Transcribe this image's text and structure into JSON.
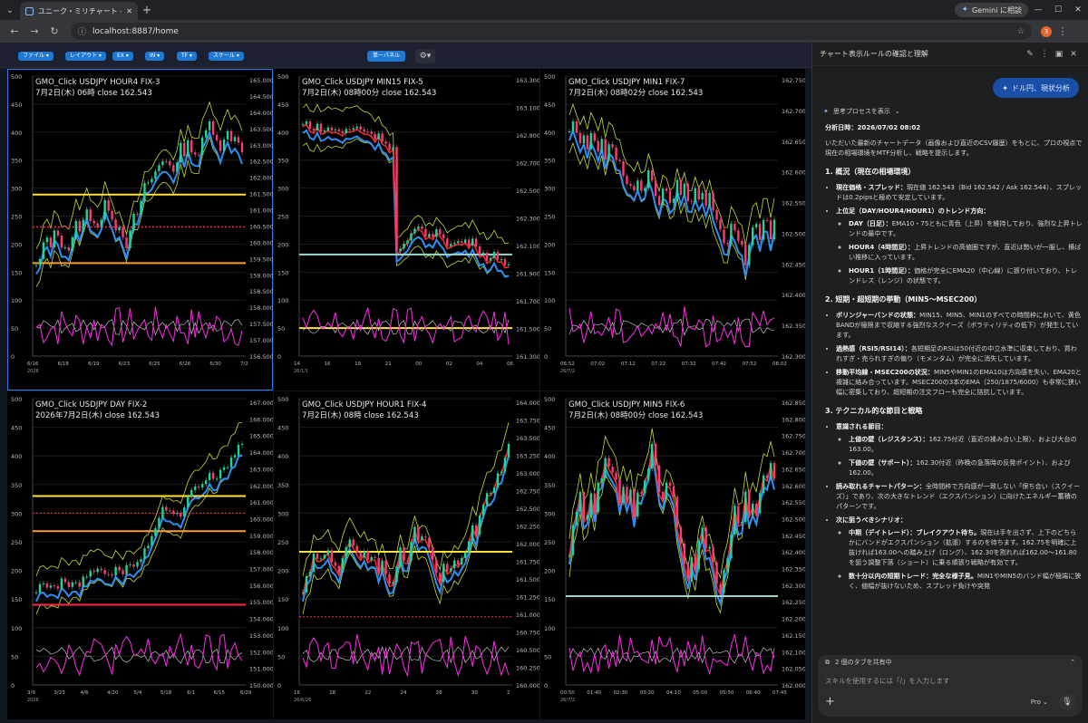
{
  "browser": {
    "tab_title": "ユニーク・ミリチャート - My-No5-un",
    "url": "localhost:8887/home",
    "gemini_button": "Gemini に相談",
    "ext_badge": "3"
  },
  "toolbar": {
    "buttons": [
      "ファイル",
      "レイアウト",
      "EX",
      "IN",
      "TF",
      "スケール"
    ],
    "single_panel": "単一パネル"
  },
  "colors": {
    "sma": "#ffe13a",
    "resist": "#ff2a4a",
    "band": "#c2dc37",
    "ema": "#2e8ff0",
    "rsi": "#ff2de8",
    "bull": "#21d49a",
    "bear": "#ff3b76",
    "support": "#9ad8d0"
  },
  "panels": [
    {
      "t1": "GMO_Click USDJPY HOUR4 FIX-3",
      "t2": "7月2日(木) 06時 close 162.543",
      "r": [
        "165.000",
        "164.500",
        "164.000",
        "163.500",
        "163.000",
        "162.500",
        "162.000",
        "161.500",
        "161.000",
        "160.500",
        "160.000",
        "159.500",
        "159.000",
        "158.500",
        "158.000",
        "157.500",
        "157.000",
        "156.500"
      ],
      "x": [
        "6/16",
        "6/18",
        "6/19",
        "6/23",
        "6/25",
        "6/26",
        "6/30",
        "7/2"
      ],
      "y2": "2026",
      "hl": [
        {
          "y": 0.423,
          "c": "#ffe13a",
          "w": 2
        },
        {
          "y": 0.539,
          "c": "#ff2a4a",
          "w": 1.5,
          "d": "2 2"
        },
        {
          "y": 0.668,
          "c": "#ff9d2a",
          "w": 2
        }
      ]
    },
    {
      "t1": "GMO_Click USDJPY MIN15 FIX-5",
      "t2": "7月2日(木) 08時00分 close 162.543",
      "r": [
        "163.300",
        "163.100",
        "162.900",
        "162.700",
        "162.500",
        "162.300",
        "162.100",
        "161.900",
        "161.700",
        "161.500",
        "161.300"
      ],
      "x": [
        "14",
        "16",
        "19",
        "21",
        "00",
        "02",
        "04",
        "06"
      ],
      "y2": "26/1/1",
      "hl": [
        {
          "y": 0.637,
          "c": "#9ad8d0",
          "w": 2
        },
        {
          "y": 0.9,
          "c": "#ffe13a",
          "w": 2
        }
      ]
    },
    {
      "t1": "GMO_Click USDJPY MIN1 FIX-7",
      "t2": "7月2日(木) 08時02分 close 162.543",
      "r": [
        "162.750",
        "162.700",
        "162.650",
        "162.600",
        "162.550",
        "162.500",
        "162.450",
        "162.400",
        "162.350",
        "162.300"
      ],
      "x": [
        "06:52",
        "07:02",
        "07:12",
        "07:22",
        "07:32",
        "07:42",
        "07:52",
        "08:02"
      ],
      "y2": "26/7/2",
      "hl": []
    },
    {
      "t1": "GMO_Click USDJPY DAY FIX-2",
      "t2": "2026年7月2日(木) close 162.543",
      "r": [
        "167.000",
        "166.000",
        "165.000",
        "164.000",
        "163.000",
        "162.000",
        "161.000",
        "160.000",
        "159.000",
        "158.000",
        "157.000",
        "156.000",
        "155.000",
        "154.000",
        "153.000",
        "152.000",
        "151.000",
        "150.000"
      ],
      "x": [
        "3/9",
        "3/23",
        "4/6",
        "4/20",
        "5/4",
        "5/18",
        "6/1",
        "6/15",
        "6/29"
      ],
      "y2": "2026",
      "hl": [
        {
          "y": 0.34,
          "c": "#ffe13a",
          "w": 2
        },
        {
          "y": 0.4,
          "c": "#ff2a4a",
          "w": 1,
          "d": "2 2"
        },
        {
          "y": 0.463,
          "c": "#ff9d2a",
          "w": 2
        },
        {
          "y": 0.72,
          "c": "#ff2a4a",
          "w": 2
        }
      ]
    },
    {
      "t1": "GMO_Click USDJPY HOUR1 FIX-4",
      "t2": "7月2日(木) 08時 close 162.543",
      "r": [
        "164.000",
        "163.750",
        "163.500",
        "163.250",
        "163.000",
        "162.750",
        "162.500",
        "162.250",
        "162.000",
        "161.750",
        "161.500",
        "161.250",
        "161.000",
        "160.750",
        "160.500",
        "160.250",
        "160.000"
      ],
      "x": [
        "16",
        "18",
        "22",
        "24",
        "28",
        "30",
        "2"
      ],
      "y2": "26/6/26",
      "hl": [
        {
          "y": 0.535,
          "c": "#ffe13a",
          "w": 2
        },
        {
          "y": 0.762,
          "c": "#ff2a4a",
          "w": 1,
          "d": "2 2"
        }
      ]
    },
    {
      "t1": "GMO_Click USDJPY MIN5 FIX-6",
      "t2": "7月2日(木) 08時00分 close 162.543",
      "r": [
        "162.850",
        "162.800",
        "162.750",
        "162.700",
        "162.650",
        "162.600",
        "162.550",
        "162.500",
        "162.450",
        "162.400",
        "162.350",
        "162.300",
        "162.250",
        "162.200",
        "162.150",
        "162.100",
        "162.050",
        "162.000"
      ],
      "x": [
        "00:50",
        "01:40",
        "02:30",
        "03:20",
        "04:10",
        "05:00",
        "05:50",
        "06:40",
        "07:45"
      ],
      "y2": "26/7/2",
      "hl": [
        {
          "y": 0.69,
          "c": "#9ad8d0",
          "w": 2
        }
      ]
    }
  ],
  "left_ticks": [
    "500",
    "450",
    "400",
    "350",
    "300",
    "250",
    "200",
    "150",
    "100",
    "50",
    "0"
  ],
  "sidebar": {
    "header": "チャート表示ルールの確認と理解",
    "user_query": "ドル円、現状分析",
    "thinking": "思考プロセスを表示",
    "date_label": "分析日時：",
    "date_value": "2026/07/02 08:02",
    "intro": "いただいた最新のチャートデータ（画像および直近のCSV履歴）をもとに、プロの視点で現在の相場環境をMTF分析し、戦略を提示します。",
    "s1": "1. 概況（現在の相場環境）",
    "s1a_b": "現在価格・スプレッド：",
    "s1a": "現在値 162.543（Bid 162.542 / Ask 162.544）、スプレッドは0.2pipsと極めて安定しています。",
    "s1b_b": "上位足（DAY/HOUR4/HOUR1）のトレンド方向：",
    "s1b1_b": "DAY（日足）：",
    "s1b1": "EMA10・75ともに青色（上昇）を維持しており、強烈な上昇トレンドの最中です。",
    "s1b2_b": "HOUR4（4時間足）：",
    "s1b2": "上昇トレンドの高値圏ですが、直近は勢いが一服し、横ばい推移に入っています。",
    "s1b3_b": "HOUR1（1時間足）：",
    "s1b3": "価格が完全にEMA20（中心線）に張り付いており、トレンドレス（レンジ）の状態です。",
    "s2": "2. 短期・超短期の挙動（MIN5〜MSEC200）",
    "s2a_b": "ボリンジャーバンドの状態：",
    "s2a": "MIN15、MIN5、MIN1のすべての時間枠において、黄色BANDが極限まで収縮する強烈なスクイーズ（ボラティリティの低下）が発生しています。",
    "s2b_b": "過熱感（RSI5/RSI14）：",
    "s2b": "各短期足のRSIは50付近の中立水準に収束しており、買われすぎ・売られすぎの偏り（モメンタム）が完全に消失しています。",
    "s2c_b": "移動平均線・MSEC200の状況：",
    "s2c": "MIN5やMIN1のEMA10は方向感を失い、EMA20と複雑に絡み合っています。MSEC200の3本のEMA（250/1875/6000）も非常に狭い幅に密集しており、超短期の注文フローも完全に拮抗しています。",
    "s3": "3. テクニカル的な節目と戦略",
    "s3a_b": "意識される節目：",
    "s3a1_b": "上値の壁（レジスタンス）：",
    "s3a1": "162.75付近（直近の揉み合い上限）、および大台の163.00。",
    "s3a2_b": "下値の壁（サポート）：",
    "s3a2": "162.30付近（昨晩の急落時の反発ポイント）、および162.00。",
    "s3b_b": "読み取れるチャートパターン：",
    "s3b": "全時間枠で方向感が一致しない「保ち合い（スクイーズ）」であり、次の大きなトレンド（エクスパンション）に向けたエネルギー蓄積のパターンです。",
    "s3c_b": "次に狙うべきシナリオ：",
    "s3c1_b": "中期（デイトレード）：ブレイクアウト待ち。",
    "s3c1": "現在は手を出さず、上下のどちらかにバンドがエクスパンション（拡張）するのを待ちます。162.75を明確に上抜ければ163.00への踏み上げ（ロング）、162.30を割れれば162.00〜161.80を狙う調整下落（ショート）に乗る順張り戦略が有効です。",
    "s3c2_b": "数十分以内の短期トレード：完全な様子見。",
    "s3c2": "MIN1やMIN5のバンド幅が極端に狭く、値幅が抜けないため、スプレッド負けや突発",
    "share": "2 個のタブを共有中",
    "input_placeholder": "スキルを使用するには「/」を入力します",
    "model": "Pro"
  }
}
